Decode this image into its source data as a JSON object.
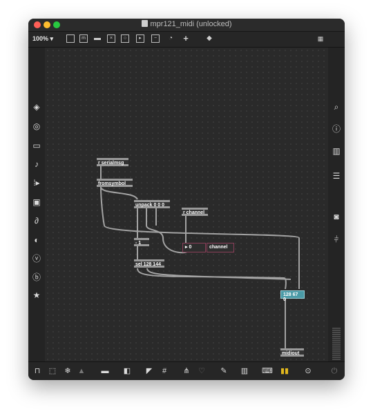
{
  "window": {
    "title": "mpr121_midi (unlocked)"
  },
  "toolbar": {
    "zoom": "100%"
  },
  "objects": {
    "r_serialmsg": "r serialmsg",
    "fromsymbol": "fromsymbol",
    "unpack": "unpack 0 0 0",
    "r_channel": "r channel",
    "minus": "- 1",
    "number": "0",
    "channel_comment": "channel",
    "sel": "sel 128 144",
    "message": "128 67 0",
    "midiout": "midiout"
  },
  "colors": {
    "accent": "#4a9aa6",
    "border": "#8b3f5a",
    "port": "#c8a942"
  },
  "icons": {
    "left": [
      "package-icon",
      "target-icon",
      "window-icon",
      "music-note-icon",
      "play-split-icon",
      "image-icon",
      "paperclip-icon",
      "plug-icon",
      "v-badge-icon",
      "b-badge-icon",
      "star-icon"
    ],
    "right": [
      "search-icon",
      "info-icon",
      "columns-icon",
      "list-icon",
      "camera-icon",
      "mixer-icon"
    ]
  }
}
